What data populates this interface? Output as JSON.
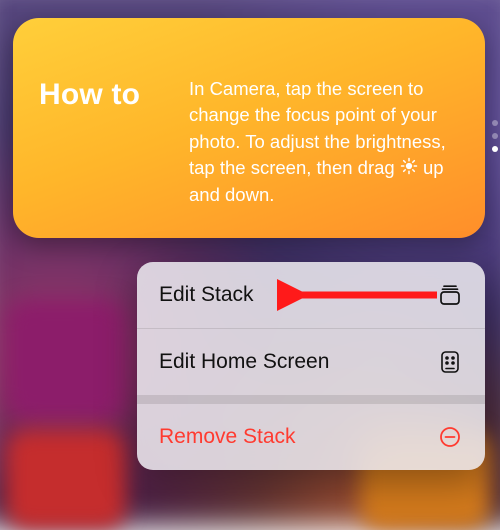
{
  "widget": {
    "title": "How to",
    "body_pre": "In Camera, tap the screen to change the focus point of your photo. To adjust the brightness, tap the screen, then drag ",
    "body_post": " up and down."
  },
  "menu": {
    "edit_stack": "Edit Stack",
    "edit_home_screen": "Edit Home Screen",
    "remove_stack": "Remove Stack"
  },
  "colors": {
    "destructive": "#ff3b30"
  }
}
